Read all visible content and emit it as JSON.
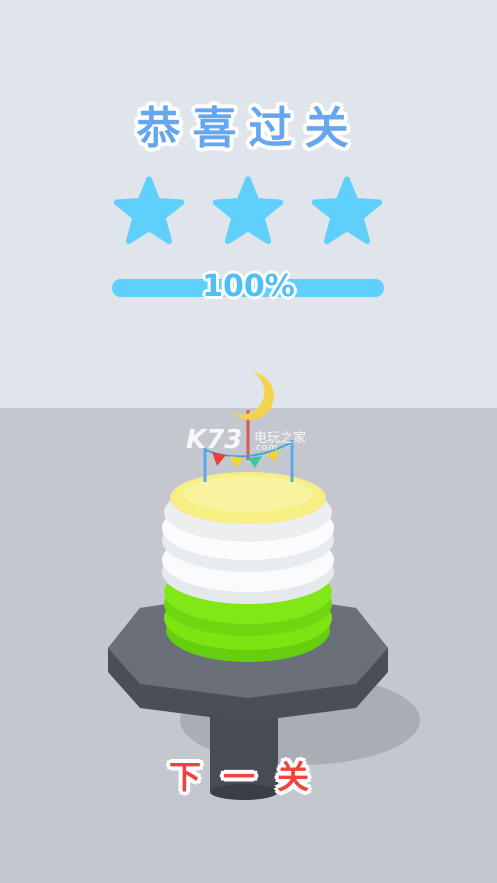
{
  "header": {
    "title": "恭喜过关"
  },
  "rating": {
    "stars_earned": 3,
    "stars_total": 3,
    "color": "#5fd0fb"
  },
  "progress": {
    "percent": 100,
    "label": "100%"
  },
  "watermark": {
    "logo": "K73",
    "site_name": "电玩之家",
    "url": ".com"
  },
  "cake": {
    "layers": [
      "yellow",
      "white",
      "white",
      "white",
      "green",
      "green",
      "green"
    ],
    "topper": "moon-bunting-topper"
  },
  "actions": {
    "next_label": "下一关"
  },
  "colors": {
    "accent_blue": "#66a6ef",
    "star_blue": "#5fd0fb",
    "button_red": "#f0443a",
    "cake_green": "#7be411",
    "cake_yellow": "#f6f08a"
  }
}
